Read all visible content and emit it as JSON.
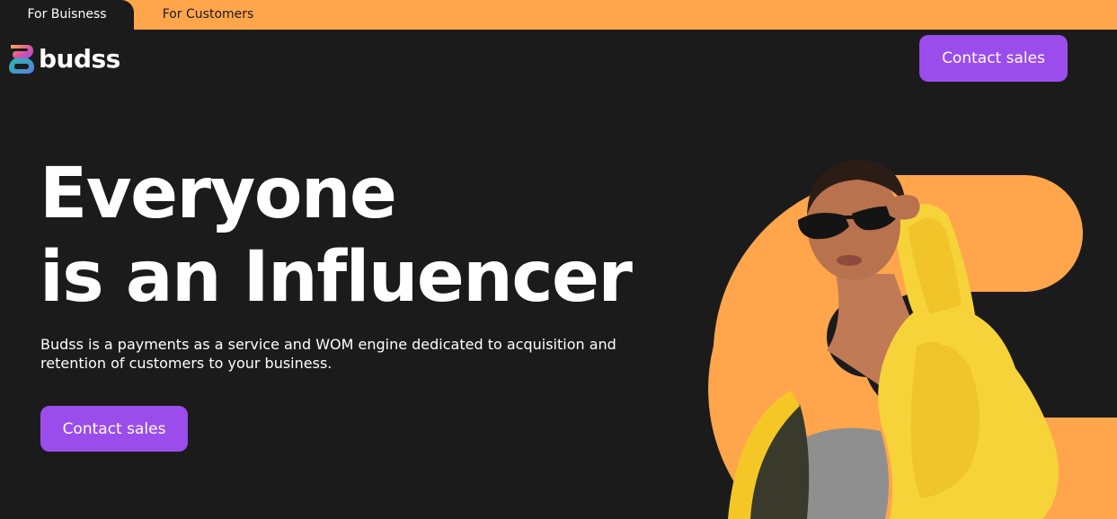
{
  "topbar": {
    "tabs": [
      {
        "label": "For Buisness",
        "active": true
      },
      {
        "label": "For Customers",
        "active": false
      }
    ]
  },
  "header": {
    "logo_text": "budss",
    "contact_label": "Contact sales"
  },
  "hero": {
    "title_line1": "Everyone",
    "title_line2": "is an Influencer",
    "subtitle": "Budss is a payments as a service and WOM engine dedicated to acquisition and retention of customers to your business.",
    "cta_label": "Contact sales",
    "image_subject": "person in yellow puffer jacket and sunglasses"
  },
  "colors": {
    "background": "#1b1b1b",
    "accent_orange": "#ffa64d",
    "button_purple": "#9b4dec",
    "text": "#ffffff"
  },
  "icons": {
    "logo": "budss-logo-icon"
  }
}
